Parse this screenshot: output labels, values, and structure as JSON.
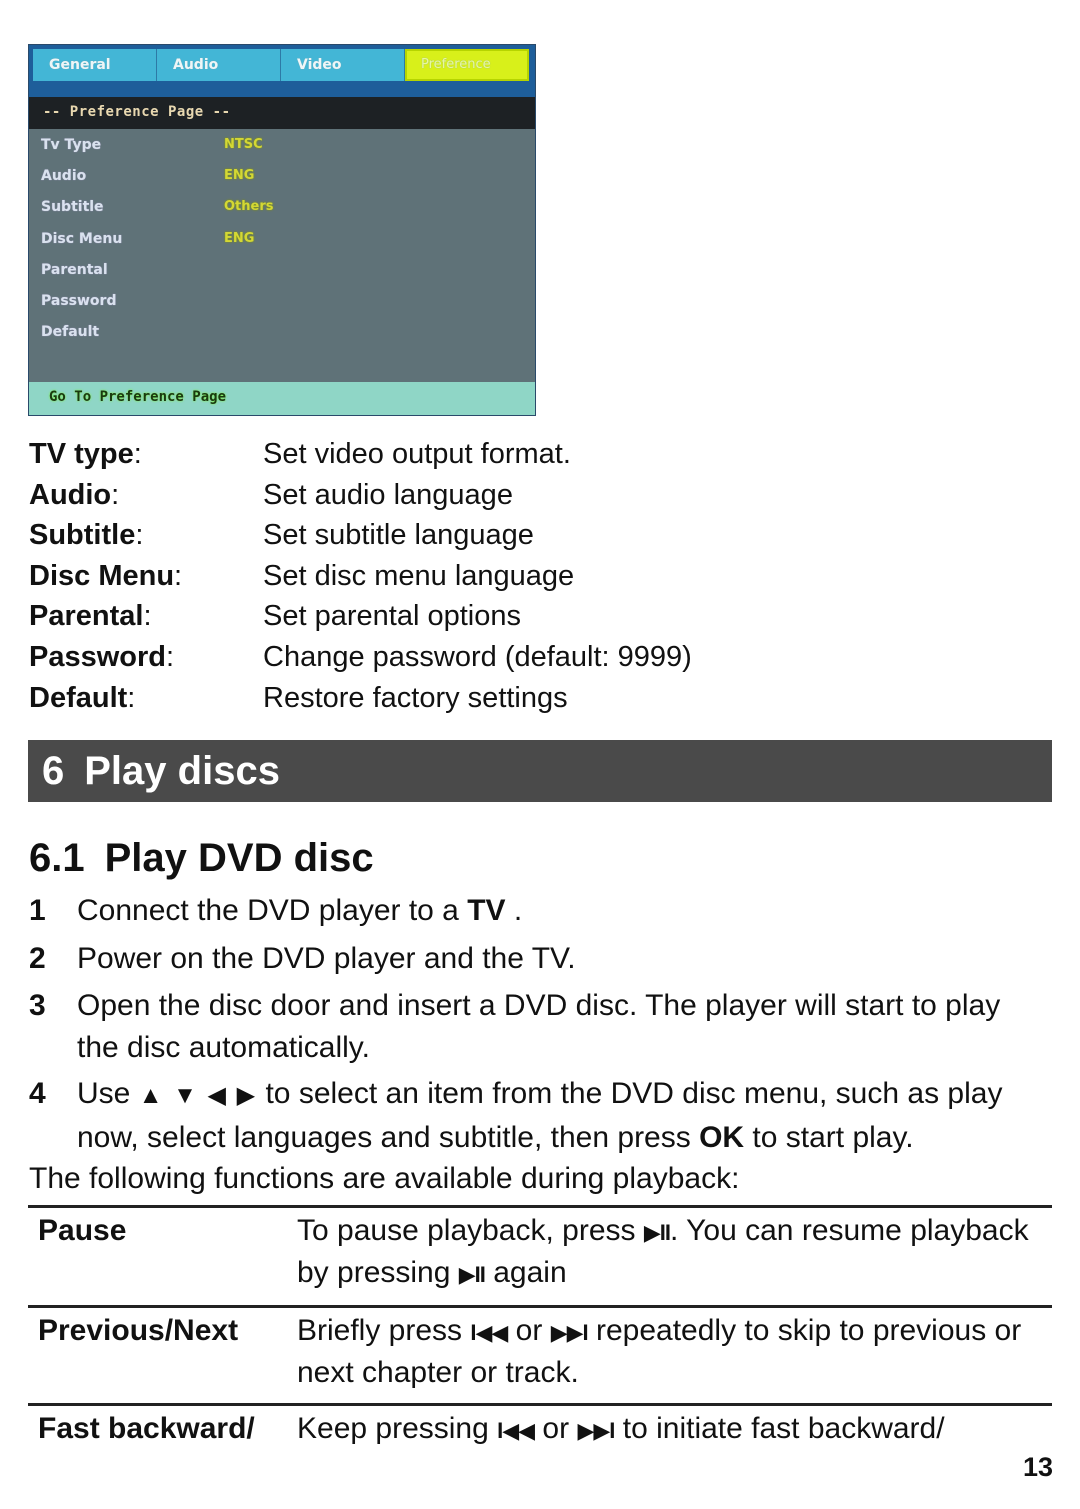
{
  "osd": {
    "tabs": [
      {
        "label": "General",
        "active": false
      },
      {
        "label": "Audio",
        "active": false
      },
      {
        "label": "Video",
        "active": false
      },
      {
        "label": "Preference",
        "active": true
      }
    ],
    "page_bar": "-- Preference Page --",
    "rows": [
      {
        "label": "Tv Type",
        "value": "NTSC"
      },
      {
        "label": "Audio",
        "value": "ENG"
      },
      {
        "label": "Subtitle",
        "value": "Others"
      },
      {
        "label": "Disc Menu",
        "value": "ENG"
      },
      {
        "label": "Parental",
        "value": ""
      },
      {
        "label": "Password",
        "value": ""
      },
      {
        "label": "Default",
        "value": ""
      }
    ],
    "footer": "Go To Preference Page",
    "colors": {
      "tab": "#43b6d6",
      "tab_active": "#d8f01a",
      "body": "#5f7278",
      "footer": "#8fd6c6"
    }
  },
  "definitions": [
    {
      "term": "TV type",
      "desc": "Set video output format."
    },
    {
      "term": "Audio",
      "desc": "Set audio language"
    },
    {
      "term": "Subtitle",
      "desc": "Set subtitle language"
    },
    {
      "term": "Disc Menu",
      "desc": "Set disc menu language"
    },
    {
      "term": "Parental",
      "desc": "Set parental options"
    },
    {
      "term": "Password",
      "desc": "Change password (default: 9999)"
    },
    {
      "term": "Default",
      "desc": "Restore factory settings"
    }
  ],
  "chapter": {
    "number": "6",
    "title": "Play discs",
    "bg": "#4a4a4a"
  },
  "section": {
    "number": "6.1",
    "title": "Play DVD disc"
  },
  "steps": [
    {
      "n": "1",
      "pre": "Connect the DVD player to a ",
      "bold": "TV",
      "post": " ."
    },
    {
      "n": "2",
      "text": "Power on the DVD player and the TV."
    },
    {
      "n": "3",
      "text": "Open the disc door and insert a DVD disc. The player will start to play the disc automatically."
    },
    {
      "n": "4",
      "pre": "Use ",
      "arrows": "▲ ▼ ◀ ▶",
      "mid": " to select an item from the DVD disc menu, such as play now, select languages and subtitle, then press ",
      "bold": "OK",
      "post": " to start play."
    }
  ],
  "intro": "The following functions are available during playback:",
  "functions": [
    {
      "name": "Pause",
      "parts": [
        "To pause playback, press ",
        "▶II",
        ". You can resume playback by pressing ",
        "▶II",
        " again"
      ]
    },
    {
      "name": "Previous/Next",
      "parts": [
        "Briefly press ",
        "I◀◀",
        " or ",
        "▶▶I",
        "  repeatedly to skip to previous or next chapter or track."
      ]
    },
    {
      "name": "Fast backward/",
      "parts": [
        "Keep pressing ",
        "I◀◀",
        " or ",
        "▶▶I",
        " to initiate fast backward/"
      ]
    }
  ],
  "page_number": "13"
}
